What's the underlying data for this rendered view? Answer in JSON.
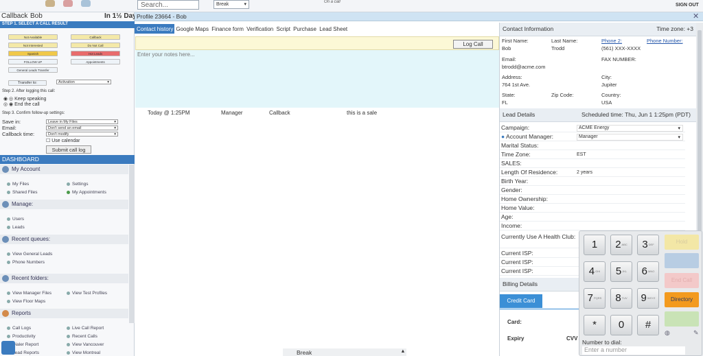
{
  "topbar": {
    "search_placeholder": "Search...",
    "status_value": "Break",
    "on_call_text": "On a call",
    "sign_out": "SIGN OUT"
  },
  "left": {
    "title": "Callback",
    "name": "Bob",
    "in_days": "In 1½ Days",
    "step1": "STEP 1. SELECT A CALL RESULT",
    "results": [
      {
        "label": "Not Available",
        "color": "#f4e9a8"
      },
      {
        "label": "Callback",
        "color": "#f4e9a8"
      },
      {
        "label": "Not Interested",
        "color": "#f4e9a8"
      },
      {
        "label": "Do Not Call",
        "color": "#f4e9a8"
      },
      {
        "label": "Spanish",
        "color": "#f0c84a"
      },
      {
        "label": "Hot Leads",
        "color": "#e86c6c"
      },
      {
        "label": "FOLLOW UP",
        "color": "#eef3f8"
      },
      {
        "label": "Appointments",
        "color": "#eef3f8"
      },
      {
        "label": "General Leads Transfer",
        "color": "#eef3f8"
      }
    ],
    "transfer_label": "Transfer to:",
    "transfer_value": "Activation",
    "step2": "Step 2. After logging this call:",
    "keep_speaking": "Keep speaking",
    "end_call": "End the call",
    "step3": "Step 3. Confirm follow-up settings:",
    "save_in_label": "Save in:",
    "save_in_value": "Leave in My Files",
    "email_label": "Email:",
    "email_value": "Don't send an email",
    "callback_time_label": "Callback time:",
    "callback_time_value": "Don't modify",
    "use_calendar": "Use calendar",
    "submit": "Submit call log"
  },
  "dashboard": {
    "title": "DASHBOARD",
    "sections": [
      {
        "label": "My Account",
        "icon": "user-icon",
        "links": [
          "My Files",
          "Settings",
          "Shared Files",
          "My Appointments"
        ]
      },
      {
        "label": "Manage:",
        "icon": "manage-icon",
        "links": [
          "Users",
          "Leads"
        ]
      },
      {
        "label": "Recent queues:",
        "icon": "queue-icon",
        "links": [
          "View General Leads",
          "Phone Numbers"
        ]
      },
      {
        "label": "Recent folders:",
        "icon": "folder-icon",
        "links": [
          "View Manager Files",
          "View Test Profiles",
          "View Floor Maps"
        ]
      },
      {
        "label": "Reports",
        "icon": "reports-icon",
        "links": [
          "Call Logs",
          "Live Call Report",
          "Productivity",
          "Recent Calls",
          "Dialer Report",
          "View Vancouver",
          "Lead Reports",
          "View Montreal"
        ]
      }
    ]
  },
  "profile": {
    "title": "Profile 23664 - Bob",
    "tabs": [
      "Contact history",
      "Google Maps",
      "Finance form",
      "Verification",
      "Script",
      "Purchase",
      "Lead Sheet"
    ],
    "log_call": "Log Call",
    "notes_placeholder": "Enter your notes here...",
    "history": {
      "date": "Today @ 1:25PM",
      "user": "Manager",
      "type": "Callback",
      "note": "this is a sale"
    }
  },
  "contact": {
    "header": "Contact Information",
    "timezone": "Time zone: +3",
    "first_name_label": "First Name:",
    "first_name": "Bob",
    "last_name_label": "Last Name:",
    "last_name": "Trodd",
    "phone2_label": "Phone 2:",
    "phone2": "(561) XXX-XXXX",
    "phone_number_label": "Phone Number:",
    "email_label": "Email:",
    "email": "btrodd@acme.com",
    "fax_label": "FAX NUMBER:",
    "address_label": "Address:",
    "address": "764 1st Ave.",
    "city_label": "City:",
    "city": "Jupiter",
    "state_label": "State:",
    "state": "FL",
    "zip_label": "Zip Code:",
    "country_label": "Country:",
    "country": "USA"
  },
  "lead": {
    "header": "Lead Details",
    "scheduled": "Scheduled time: Thu, Jun 1 1:25pm (PDT)",
    "rows": [
      {
        "label": "Campaign:",
        "value": "ACME Energy"
      },
      {
        "label": "Account Manager:",
        "value": "Manager"
      },
      {
        "label": "Marital Status:",
        "value": ""
      },
      {
        "label": "Time Zone:",
        "value": "EST"
      },
      {
        "label": "SALES:",
        "value": ""
      },
      {
        "label": "Length Of Residence:",
        "value": "2 years"
      },
      {
        "label": "Birth Year:",
        "value": ""
      },
      {
        "label": "Gender:",
        "value": ""
      },
      {
        "label": "Home Ownership:",
        "value": ""
      },
      {
        "label": "Home Value:",
        "value": ""
      },
      {
        "label": "Age:",
        "value": ""
      },
      {
        "label": "Income:",
        "value": ""
      },
      {
        "label": "Currently Use A Health Club:",
        "value": ""
      },
      {
        "label": "Current ISP:",
        "value": ""
      },
      {
        "label": "Current ISP:",
        "value": ""
      },
      {
        "label": "Current ISP:",
        "value": ""
      }
    ]
  },
  "billing": {
    "header": "Billing Details",
    "credit_card": "Credit Card",
    "card_label": "Card:",
    "expiry_label": "Expiry",
    "cvv_label": "CVV"
  },
  "keypad": {
    "keys": [
      {
        "d": "1",
        "s": ""
      },
      {
        "d": "2",
        "s": "ABC"
      },
      {
        "d": "3",
        "s": "DEF"
      },
      {
        "d": "4",
        "s": "GHI"
      },
      {
        "d": "5",
        "s": "JKL"
      },
      {
        "d": "6",
        "s": "MNO"
      },
      {
        "d": "7",
        "s": "PQRS"
      },
      {
        "d": "8",
        "s": "TUV"
      },
      {
        "d": "9",
        "s": "WXYZ"
      },
      {
        "d": "*",
        "s": ""
      },
      {
        "d": "0",
        "s": ""
      },
      {
        "d": "#",
        "s": ""
      }
    ],
    "hold": "Hold",
    "end_call": "End Call",
    "directory": "Directory",
    "number_label": "Number to dial:",
    "number_placeholder": "Enter a number"
  },
  "bottom": {
    "break_label": "Break"
  }
}
